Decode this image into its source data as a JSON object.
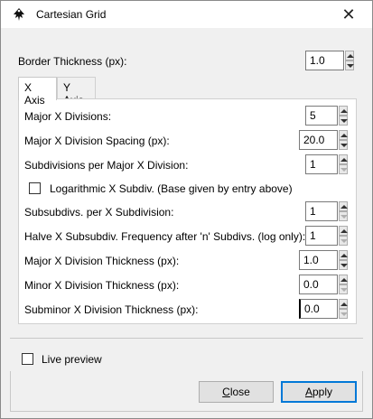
{
  "window": {
    "title": "Cartesian Grid",
    "close_glyph": "✕"
  },
  "border": {
    "label": "Border Thickness (px):",
    "value": "1.0"
  },
  "tabs": [
    {
      "label": "X Axis",
      "active": true
    },
    {
      "label": "Y Axis",
      "active": false
    }
  ],
  "x_axis": {
    "major_divisions": {
      "label": "Major X Divisions:",
      "value": "5"
    },
    "major_spacing": {
      "label": "Major X Division Spacing (px):",
      "value": "20.0"
    },
    "subdivisions": {
      "label": "Subdivisions per Major X Division:",
      "value": "1"
    },
    "logarithmic": {
      "label": "Logarithmic X Subdiv. (Base given by entry above)",
      "checked": false
    },
    "subsubdivs": {
      "label": "Subsubdivs. per X Subdivision:",
      "value": "1"
    },
    "halve": {
      "label": "Halve X Subsubdiv. Frequency after 'n' Subdivs. (log only):",
      "value": "1"
    },
    "major_thickness": {
      "label": "Major X Division Thickness (px):",
      "value": "1.0"
    },
    "minor_thickness": {
      "label": "Minor X Division Thickness (px):",
      "value": "0.0"
    },
    "subminor_thickness": {
      "label": "Subminor X Division Thickness (px):",
      "value": "0.0"
    }
  },
  "live_preview": {
    "label": "Live preview",
    "checked": false
  },
  "buttons": {
    "close": {
      "label_first": "C",
      "label_rest": "lose"
    },
    "apply": {
      "label_first": "A",
      "label_rest": "pply"
    }
  },
  "icons": {
    "app": "inkscape-icon",
    "close": "close-icon",
    "spin_up": "spin-up-icon",
    "spin_down": "spin-down-icon"
  }
}
